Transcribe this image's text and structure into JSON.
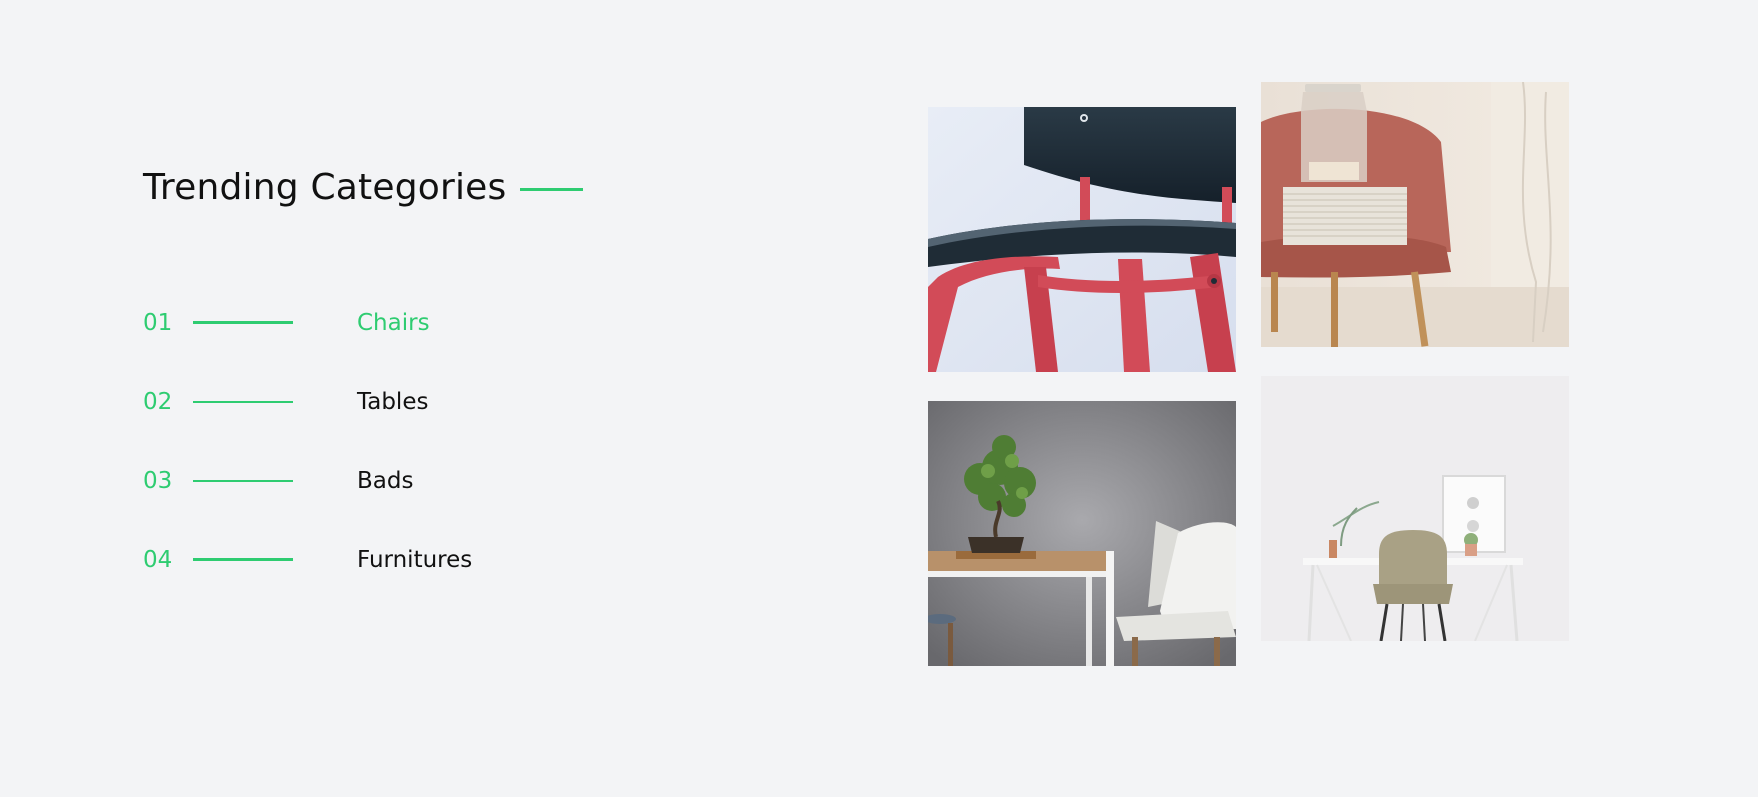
{
  "section": {
    "title": "Trending Categories"
  },
  "categories": [
    {
      "number": "01",
      "label": "Chairs",
      "active": true
    },
    {
      "number": "02",
      "label": "Tables",
      "active": false
    },
    {
      "number": "03",
      "label": "Bads",
      "active": false
    },
    {
      "number": "04",
      "label": "Furnitures",
      "active": false
    }
  ],
  "colors": {
    "accent": "#2ecc71",
    "background": "#f3f4f6",
    "text": "#111111"
  },
  "gallery": [
    {
      "subject": "black-seat-red-leg-chair"
    },
    {
      "subject": "pink-velvet-chair-with-books-and-jar"
    },
    {
      "subject": "wooden-table-with-bonsai-and-white-chairs"
    },
    {
      "subject": "white-desk-with-beige-chair"
    }
  ]
}
